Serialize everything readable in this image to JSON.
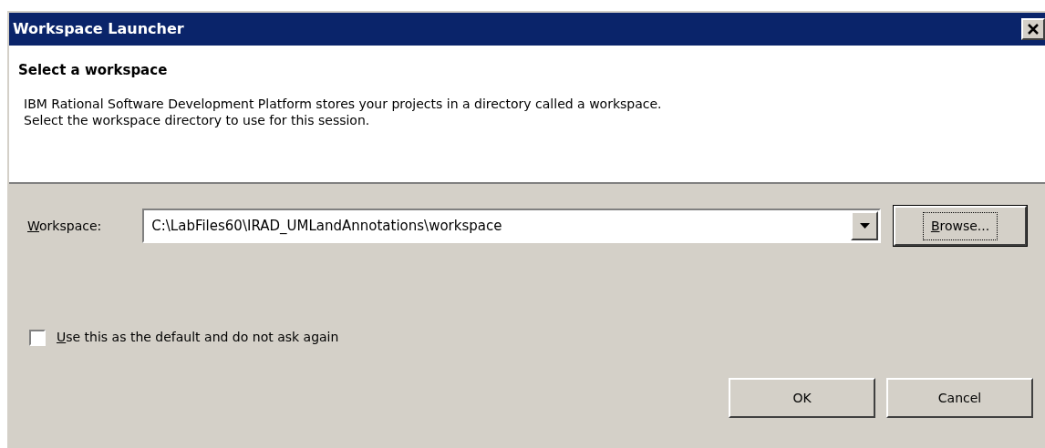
{
  "window": {
    "title": "Workspace Launcher"
  },
  "header": {
    "title": "Select a workspace",
    "description": [
      "IBM Rational Software Development Platform stores your projects in a directory called a workspace.",
      "Select the workspace directory to use for this session."
    ]
  },
  "workspace": {
    "label": "Workspace:",
    "mnemonic_underlined": true,
    "value": "C:\\LabFiles60\\IRAD_UMLandAnnotations\\workspace"
  },
  "browse_button": {
    "label": "Browse...",
    "mnemonic_underlined": true,
    "focused": true
  },
  "default_checkbox": {
    "label": "Use this as the default and do not ask again",
    "mnemonic_underlined": true,
    "checked": false
  },
  "buttons": [
    {
      "label": "OK"
    },
    {
      "label": "Cancel"
    }
  ]
}
